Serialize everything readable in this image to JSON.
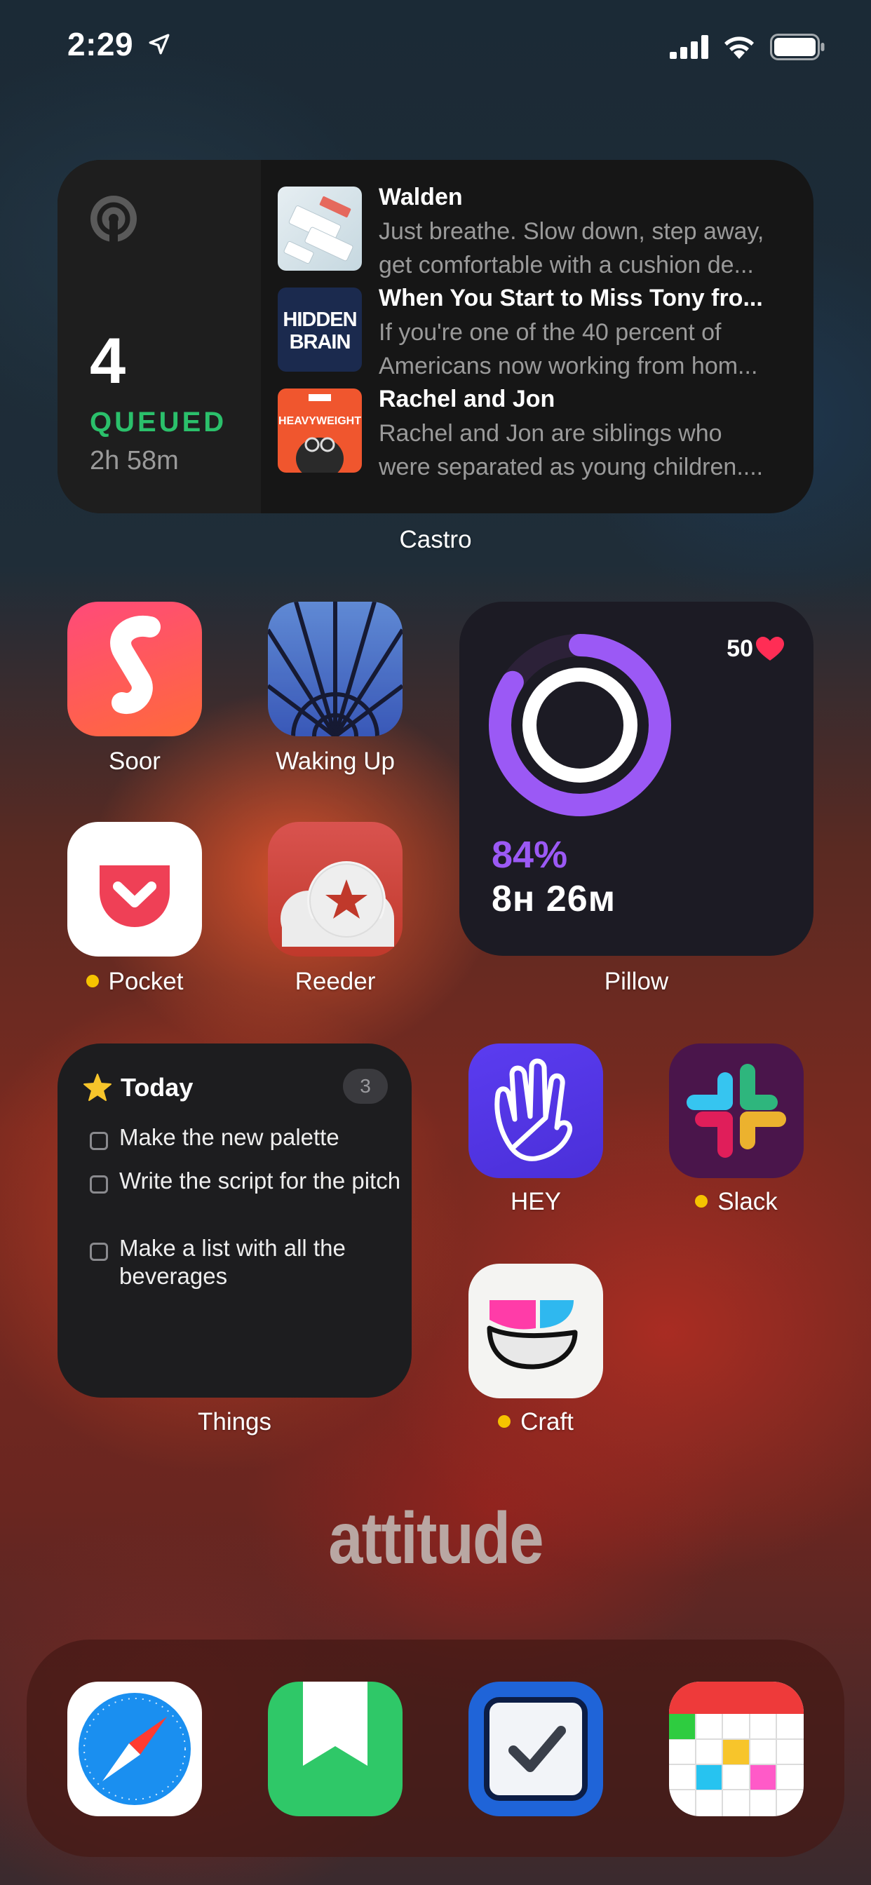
{
  "status_bar": {
    "time": "2:29"
  },
  "castro": {
    "count": "4",
    "queued_label": "QUEUED",
    "duration": "2h 58m",
    "widget_label": "Castro",
    "episodes": [
      {
        "title": "Walden",
        "desc_line1": "Just breathe. Slow down, step away,",
        "desc_line2": "get comfortable with a cushion de..."
      },
      {
        "title": "When You Start to Miss Tony fro...",
        "desc_line1": "If you're one of the 40 percent of",
        "desc_line2": "Americans now working from hom..."
      },
      {
        "title": "Rachel and Jon",
        "desc_line1": "Rachel and Jon are siblings who",
        "desc_line2": "were separated as young children...."
      }
    ],
    "art": {
      "hidden_brain_line1": "HIDDEN",
      "hidden_brain_line2": "BRAIN",
      "heavyweight": "HEAVYWEIGHT"
    }
  },
  "apps": {
    "soor": "Soor",
    "waking_up": "Waking Up",
    "pocket": "Pocket",
    "reeder": "Reeder",
    "hey": "HEY",
    "slack": "Slack",
    "craft": "Craft"
  },
  "pillow": {
    "heart_rate": "50",
    "percent": "84%",
    "duration": "8н 26м",
    "ring_fraction": 0.84,
    "widget_label": "Pillow"
  },
  "things": {
    "title": "Today",
    "badge": "3",
    "widget_label": "Things",
    "items": [
      {
        "text": "Make the new palette"
      },
      {
        "text": "Write the script for the pitch"
      },
      {
        "text": "Make a list with all the beverages"
      }
    ]
  },
  "wallpaper_text": "attitude",
  "colors": {
    "castro_green": "#2bc06b",
    "pillow_purple": "#9b59f5",
    "heart_red": "#ff2d55",
    "notification_dot": "#f5c300"
  }
}
